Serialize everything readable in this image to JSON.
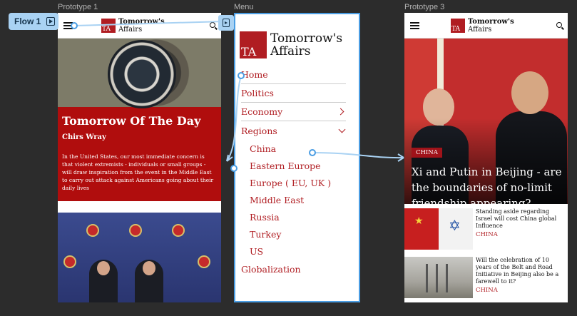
{
  "canvas": {
    "frame_labels": {
      "prototype1": "Prototype 1",
      "menu": "Menu",
      "prototype3": "Prototype 3"
    },
    "flow_badge": "Flow 1"
  },
  "brand": {
    "mark": "TA",
    "line1": "Tomorrow's",
    "line2": "Affairs",
    "color": "#b01d22"
  },
  "prototype1": {
    "featured": {
      "title": "Tomorrow Of The Day",
      "author": "Chirs Wray",
      "body": "In the United States, our most immediate concern is that violent extremists - individuals or small groups - will draw inspiration from the event in the Middle East to carry out attack against Americans going about their daily lives"
    },
    "seal_text": "DEPARTMENT OF JUSTICE"
  },
  "menu": {
    "items": [
      {
        "label": "Home"
      },
      {
        "label": "Politics"
      },
      {
        "label": "Economy",
        "chevron": "chevron-right-icon"
      },
      {
        "label": "Regions",
        "chevron": "chevron-down-icon"
      }
    ],
    "regions": [
      "China",
      "Eastern Europe",
      "Europe ( EU, UK )",
      "Middle East",
      "Russia",
      "Turkey",
      "US"
    ],
    "last_item": "Globalization"
  },
  "prototype3": {
    "hero": {
      "tag": "CHINA",
      "title": "Xi and Putin in Beijing - are the boundaries of no-limit friendship appearing?"
    },
    "articles": [
      {
        "title": "Standing aside regarding Israel will cost China global Influence",
        "category": "CHINA"
      },
      {
        "title": "Will the celebration of 10 years of the Belt and Road Initiative in Beijing also be a farewell to it?",
        "category": "CHINA"
      }
    ]
  },
  "colors": {
    "accent": "#4a9de3",
    "canvas": "#2c2c2c",
    "featured_red": "#b00d0d"
  }
}
